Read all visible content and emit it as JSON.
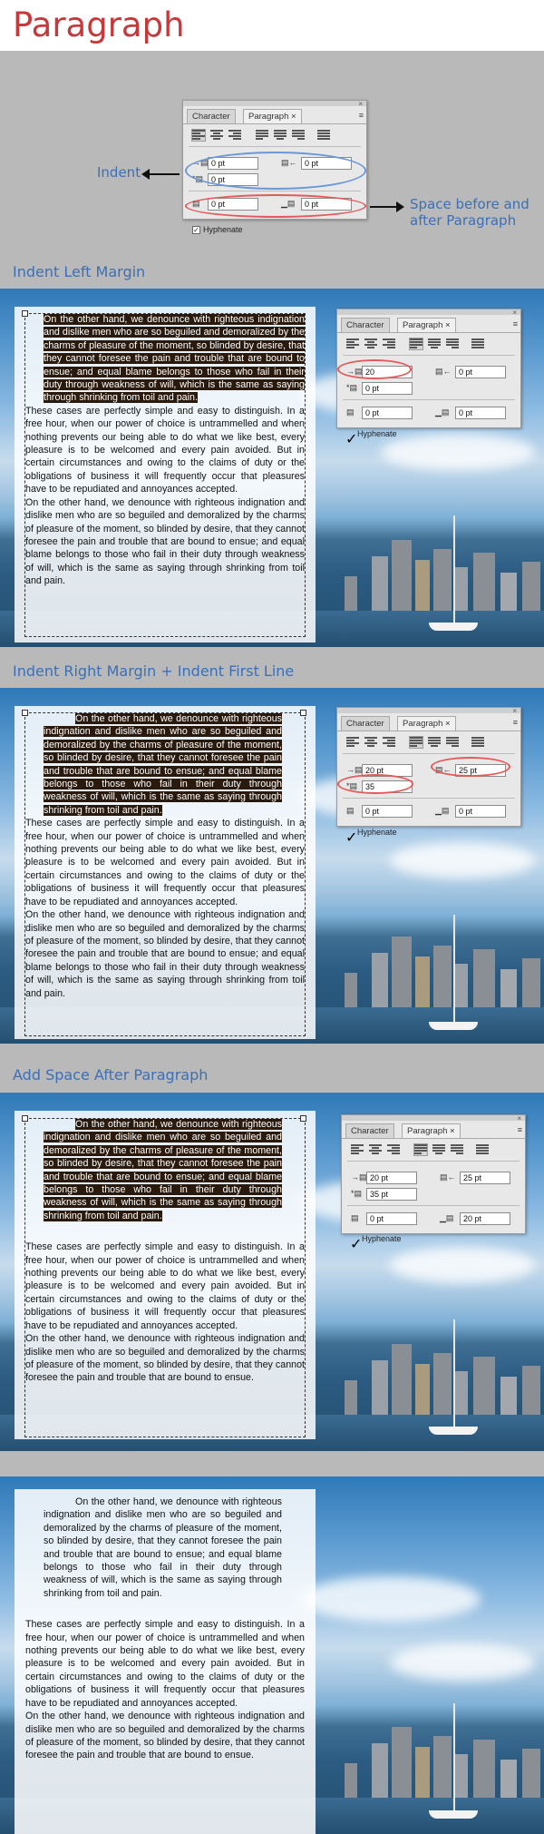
{
  "title": "Paragraph",
  "colors": {
    "title": "#c8383a",
    "label": "#3c6fb6",
    "highlight_oval": "#e45a5a",
    "indent_oval": "#6b98d6",
    "text_highlight": "#2a1a0d"
  },
  "callouts": {
    "indent": "Indent",
    "space_line1": "Space before and",
    "space_line2": "after Paragraph"
  },
  "sections": [
    {
      "label": "Indent Left Margin"
    },
    {
      "label": "Indent Right Margin + Indent First Line"
    },
    {
      "label": "Add Space After Paragraph"
    }
  ],
  "panel": {
    "tab_character": "Character",
    "tab_paragraph": "Paragraph",
    "close_glyph": "×",
    "hyphenate_label": "Hyphenate",
    "check_glyph": "✓",
    "menu_glyph": "≡",
    "icons": [
      "align-left-icon",
      "align-center-icon",
      "align-right-icon",
      "justify-last-left-icon",
      "justify-last-center-icon",
      "justify-last-right-icon",
      "justify-all-icon",
      "left-indent-icon",
      "right-indent-icon",
      "first-line-indent-icon",
      "space-before-icon",
      "space-after-icon"
    ]
  },
  "panels": [
    {
      "left_indent": "0 pt",
      "right_indent": "0 pt",
      "first_line": "0 pt",
      "space_before": "0 pt",
      "space_after": "0 pt"
    },
    {
      "left_indent": "20",
      "right_indent": "0 pt",
      "first_line": "0 pt",
      "space_before": "0 pt",
      "space_after": "0 pt"
    },
    {
      "left_indent": "20 pt",
      "right_indent": "25 pt",
      "first_line": "35",
      "space_before": "0 pt",
      "space_after": "0 pt"
    },
    {
      "left_indent": "20 pt",
      "right_indent": "25 pt",
      "first_line": "35 pt",
      "space_before": "0 pt",
      "space_after": "20 pt"
    }
  ],
  "text": {
    "p1": "On the other hand, we denounce with righteous indignation and dislike men who are so beguiled and demoralized by the charms of pleasure of the moment, so blinded by desire, that they cannot foresee the pain and trouble that are bound to ensue; and equal blame belongs to those who fail in their duty through weakness of will, which is the same as saying through shrinking from toil and pain.",
    "p2": "These cases are perfectly simple and easy to distinguish. In a free hour, when our power of choice is untrammelled and when nothing prevents our being able to do what we like best, every pleasure is to be welcomed and every pain avoided. But in certain circumstances and owing to the claims of duty or the obligations of business it will frequently occur that pleasures have to be repudiated and annoyances accepted.",
    "p3a": "On the other hand, we denounce with righteous indignation and dislike men who are so beguiled and demoralized by the charms of pleasure of the moment, so blinded by desire, that they cannot foresee the pain and trouble that are bound to ensue; and equal blame belongs to those who fail in their duty through weakness of will, which is the same as saying through shrinking from toil and pain.",
    "p3b": "On the other hand, we denounce with righteous indignation and dislike men who are so beguiled and demoralized by the charms of pleasure of the moment, so blinded by desire, that they cannot foresee the pain and trouble that are bound to ensue."
  }
}
